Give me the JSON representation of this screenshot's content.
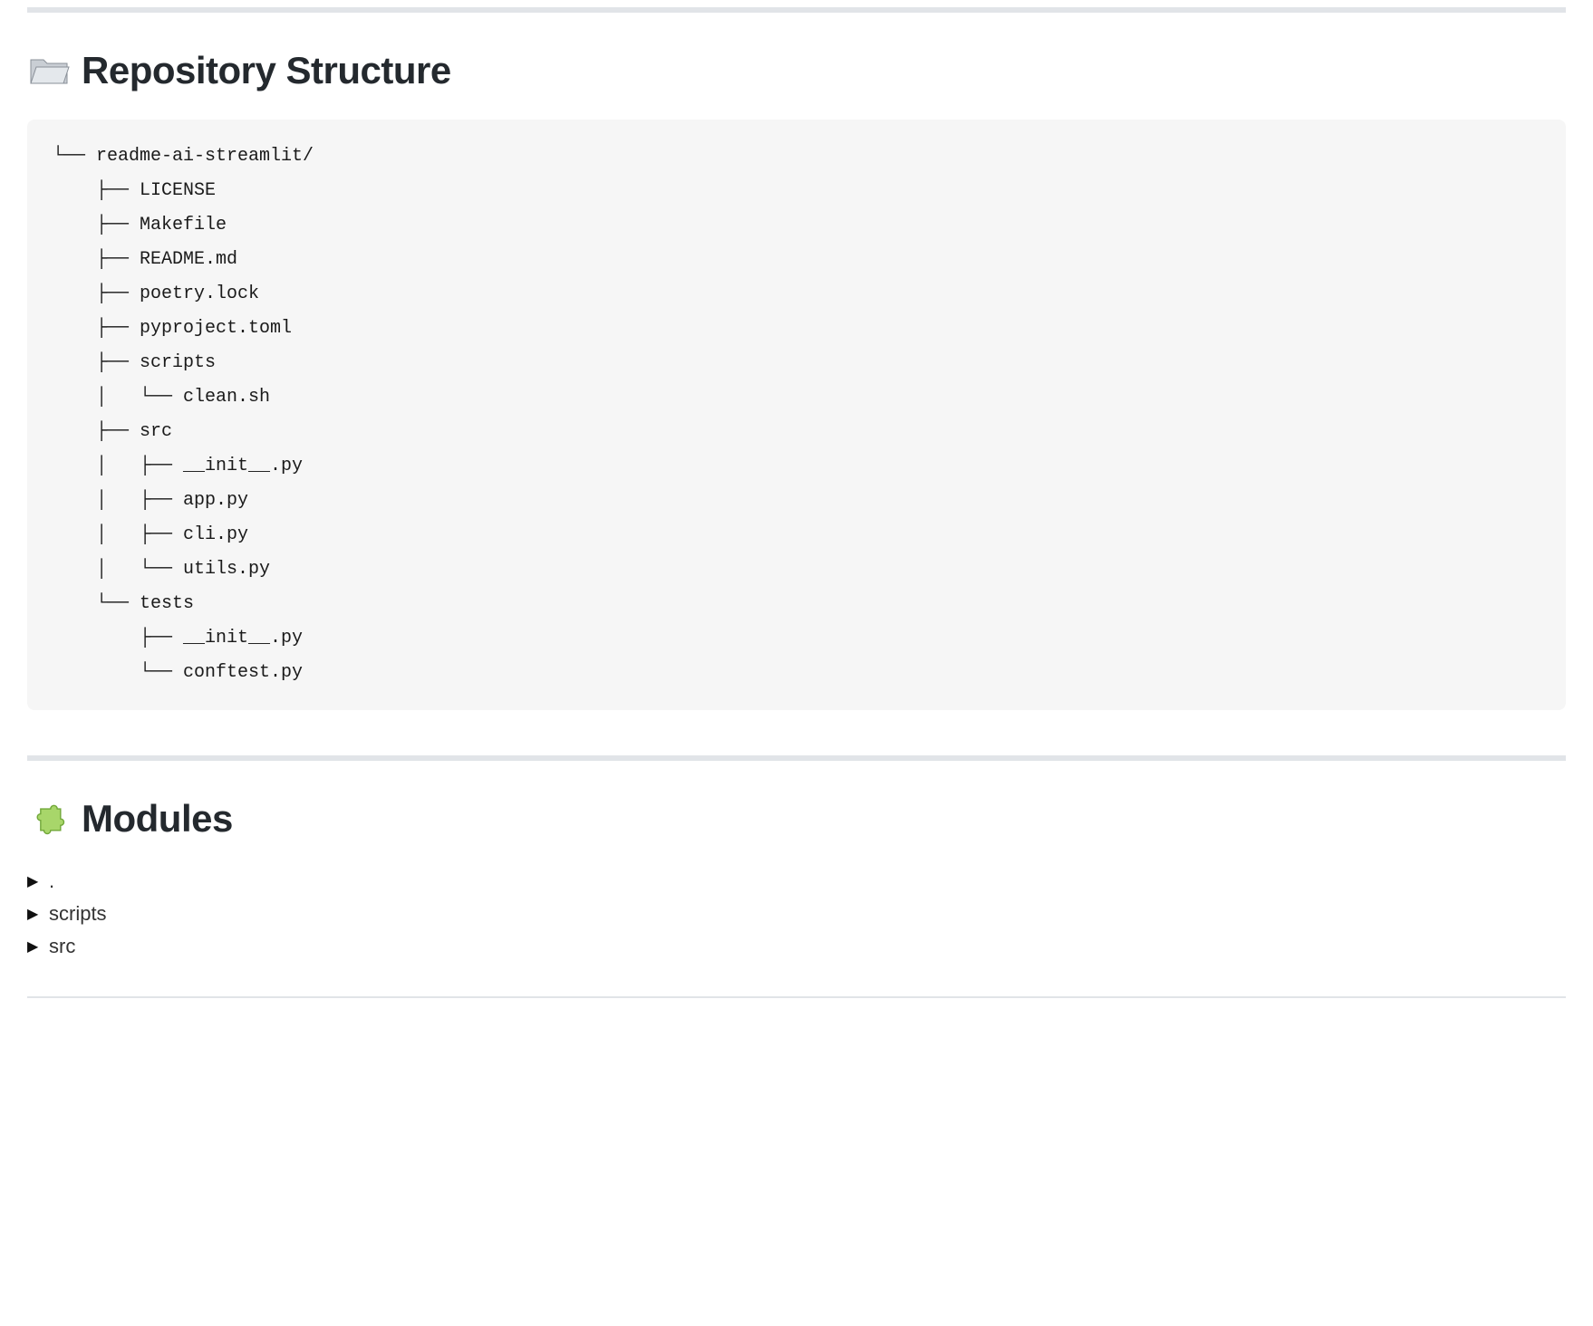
{
  "sections": {
    "repo_structure": {
      "icon": "folder-open-icon",
      "title": "Repository Structure",
      "tree": "└── readme-ai-streamlit/\n    ├── LICENSE\n    ├── Makefile\n    ├── README.md\n    ├── poetry.lock\n    ├── pyproject.toml\n    ├── scripts\n    │   └── clean.sh\n    ├── src\n    │   ├── __init__.py\n    │   ├── app.py\n    │   ├── cli.py\n    │   └── utils.py\n    └── tests\n        ├── __init__.py\n        └── conftest.py"
    },
    "modules": {
      "icon": "puzzle-piece-icon",
      "title": "Modules",
      "items": [
        {
          "label": "."
        },
        {
          "label": "scripts"
        },
        {
          "label": "src"
        }
      ]
    }
  }
}
